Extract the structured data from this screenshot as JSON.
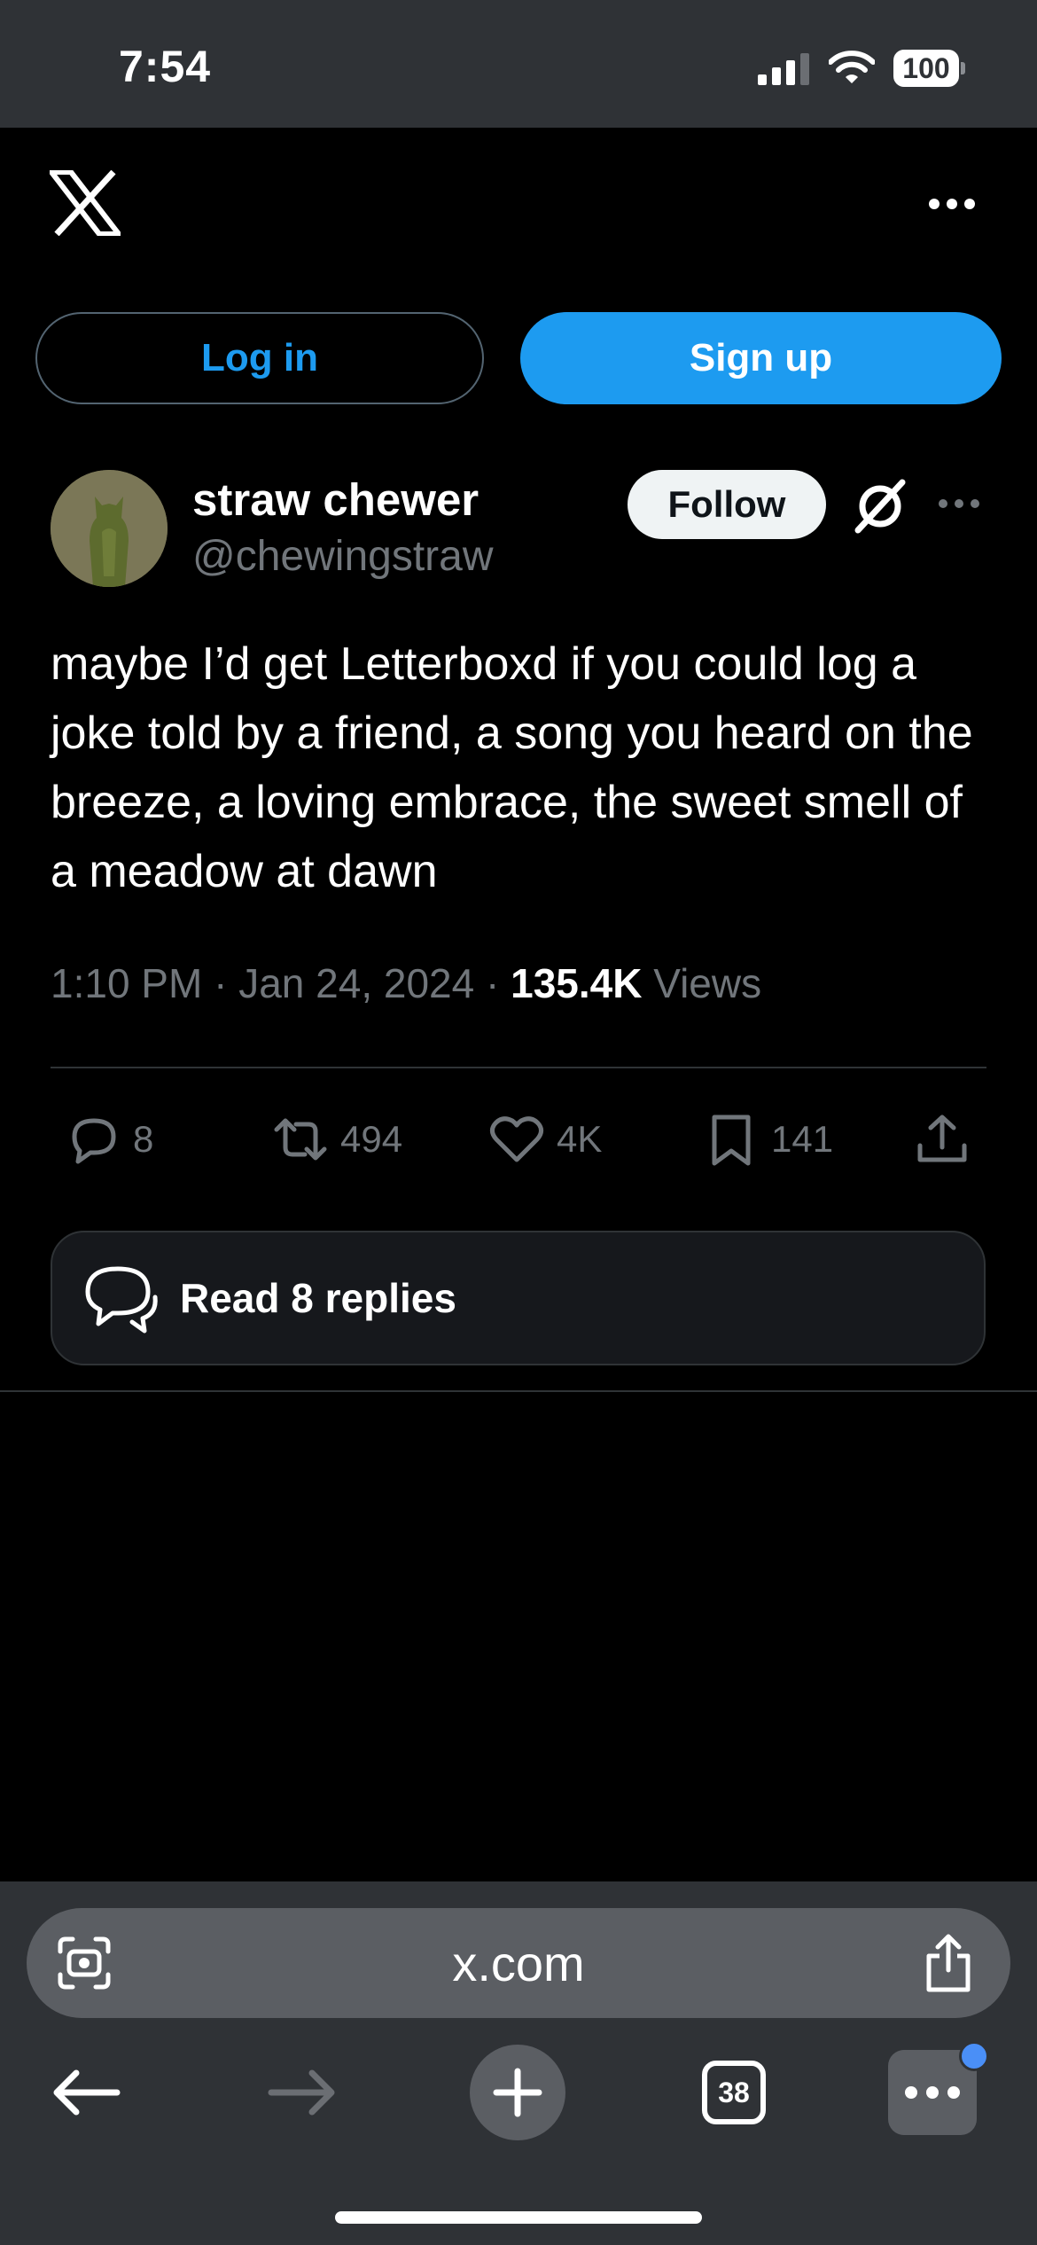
{
  "status_bar": {
    "time": "7:54",
    "battery": "100"
  },
  "header": {
    "logo": "x-logo",
    "more_icon": "more-horizontal-icon"
  },
  "auth": {
    "login_label": "Log in",
    "signup_label": "Sign up"
  },
  "tweet": {
    "display_name": "straw chewer",
    "handle": "@chewingstraw",
    "follow_label": "Follow",
    "text": "maybe I’d get Letterboxd if you could log a joke told by a friend, a song you heard on the breeze, a loving embrace, the sweet smell of a meadow at dawn",
    "time": "1:10 PM",
    "date": "Jan 24, 2024",
    "views_count": "135.4K",
    "views_label": "Views",
    "stats": {
      "replies": "8",
      "reposts": "494",
      "likes": "4K",
      "bookmarks": "141"
    },
    "read_replies_label": "Read 8 replies"
  },
  "browser": {
    "url": "x.com",
    "tab_count": "38"
  },
  "colors": {
    "accent": "#1d9bf0",
    "background": "#000000",
    "muted": "#71767b",
    "browser_chrome": "#2f3236"
  }
}
